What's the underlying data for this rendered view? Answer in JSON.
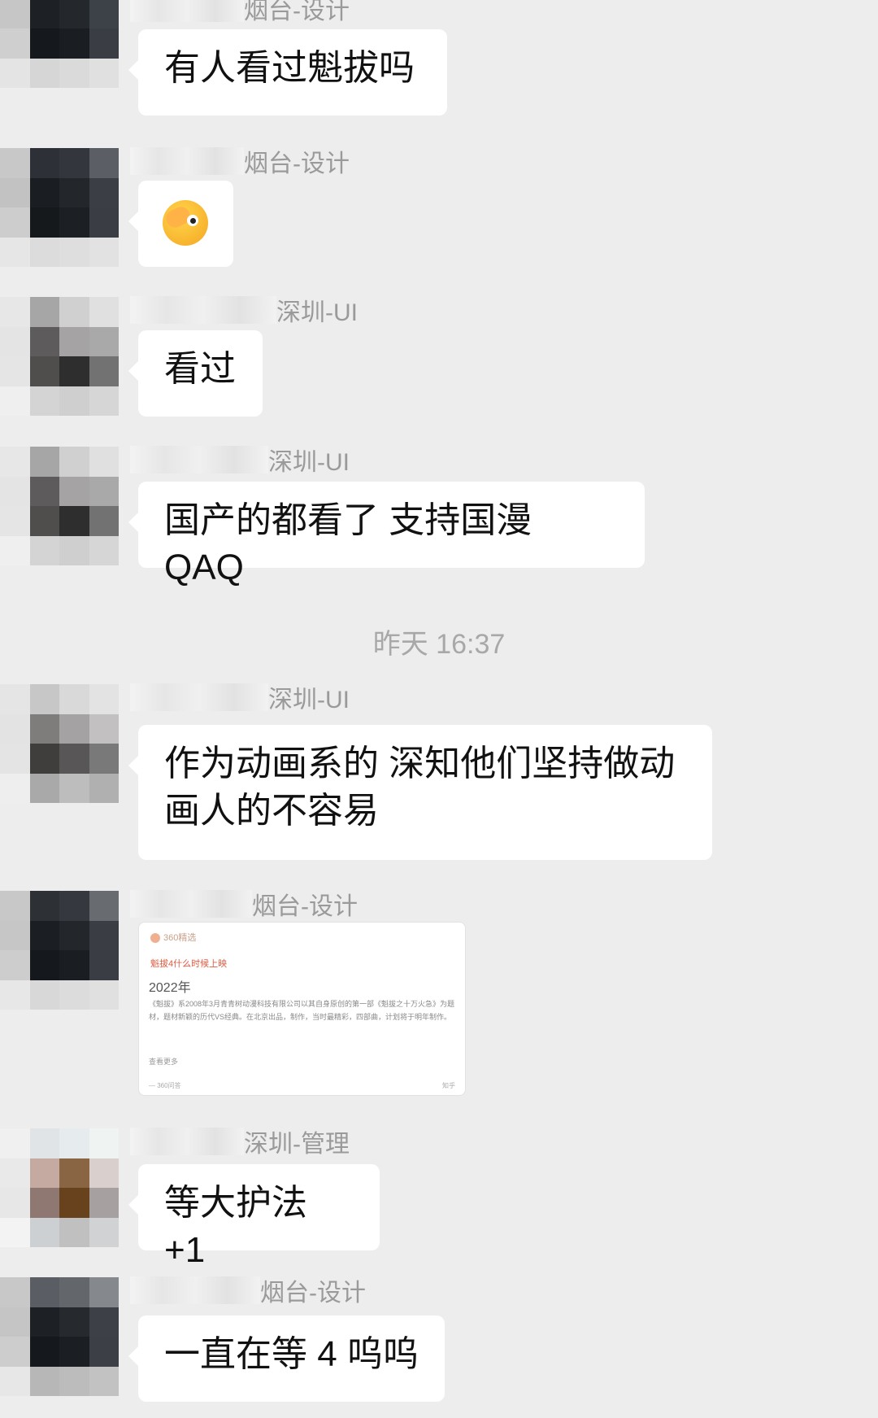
{
  "messages": [
    {
      "sender": "烟台-设计",
      "text": "有人看过魁拔吗"
    },
    {
      "sender": "烟台-设计",
      "emoji": "covering-eye-face-emoji"
    },
    {
      "sender": "深圳-UI",
      "text": "看过"
    },
    {
      "sender": "深圳-UI",
      "text": "国产的都看了 支持国漫 QAQ"
    },
    {
      "sender": "深圳-UI",
      "text": "作为动画系的 深知他们坚持做动画人的不容易"
    },
    {
      "sender": "烟台-设计",
      "card": {
        "source": "360精选",
        "headline": "魁拔4什么时候上映",
        "year": "2022年",
        "body": "《魁拔》系2008年3月青青树动漫科技有限公司以其自身原创的第一部《魁拔之十万火急》为题材，题材新颖的历代VS经典。在北京出品，制作，当时最精彩，四部曲，计划将于明年制作。",
        "more": "查看更多",
        "footer_left": "— 360问答",
        "footer_right": "知乎"
      }
    },
    {
      "sender": "深圳-管理",
      "text": "等大护法 +1"
    },
    {
      "sender": "烟台-设计",
      "text": "一直在等 4 呜呜"
    }
  ],
  "timestamp": "昨天 16:37",
  "colors": {
    "background": "#ededed",
    "bubble": "#ffffff",
    "sender": "#9a9a9a",
    "timestamp": "#a8a8a8"
  }
}
